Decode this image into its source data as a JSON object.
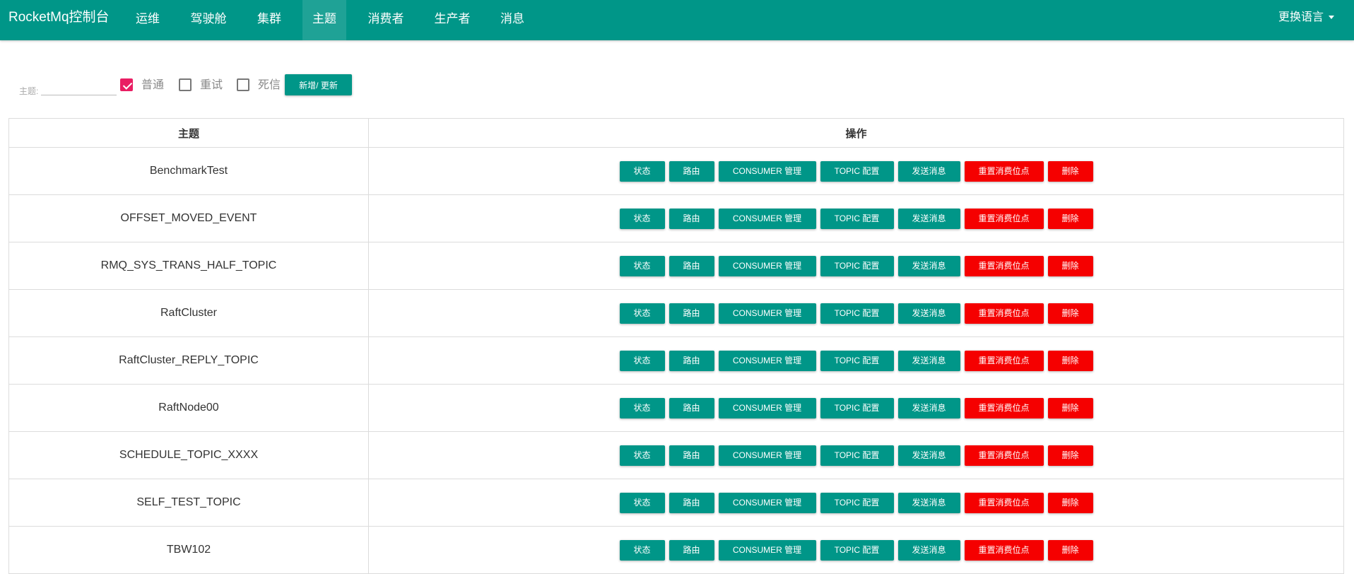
{
  "navbar": {
    "brand": "RocketMq控制台",
    "items": [
      "运维",
      "驾驶舱",
      "集群",
      "主题",
      "消费者",
      "生产者",
      "消息"
    ],
    "active_index": 3,
    "language": "更换语言"
  },
  "filter": {
    "topic_label": "主题:",
    "topic_value": "",
    "checkboxes": [
      {
        "label": "普通",
        "checked": true
      },
      {
        "label": "重试",
        "checked": false
      },
      {
        "label": "死信",
        "checked": false
      }
    ],
    "add_update_button": "新增/ 更新"
  },
  "table": {
    "headers": [
      "主题",
      "操作"
    ],
    "actions": [
      "状态",
      "路由",
      "CONSUMER 管理",
      "TOPIC 配置",
      "发送消息",
      "重置消费位点",
      "删除"
    ],
    "rows": [
      "BenchmarkTest",
      "OFFSET_MOVED_EVENT",
      "RMQ_SYS_TRANS_HALF_TOPIC",
      "RaftCluster",
      "RaftCluster_REPLY_TOPIC",
      "RaftNode00",
      "SCHEDULE_TOPIC_XXXX",
      "SELF_TEST_TOPIC",
      "TBW102"
    ]
  },
  "colors": {
    "primary": "#009688",
    "danger": "#f50000",
    "checkbox_checked": "#e91e63"
  }
}
